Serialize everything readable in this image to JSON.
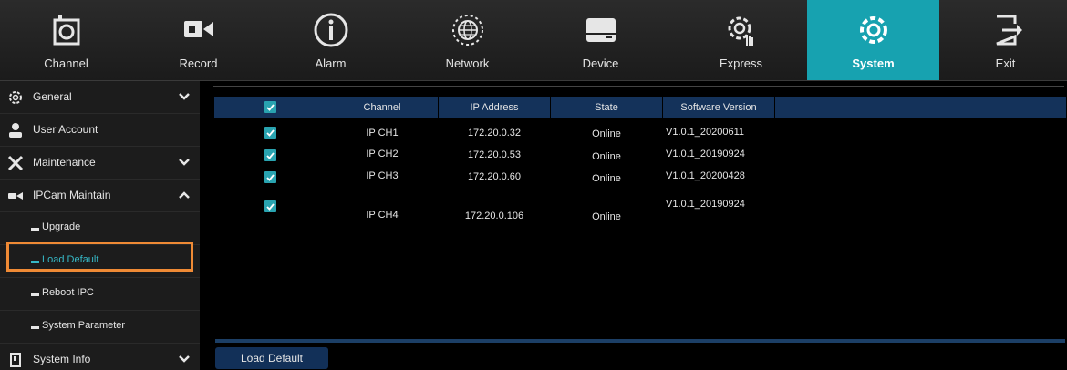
{
  "top_tabs": [
    {
      "label": "Channel",
      "icon": "camera-icon"
    },
    {
      "label": "Record",
      "icon": "video-camera-icon"
    },
    {
      "label": "Alarm",
      "icon": "info-icon"
    },
    {
      "label": "Network",
      "icon": "globe-icon"
    },
    {
      "label": "Device",
      "icon": "hard-drive-icon"
    },
    {
      "label": "Express",
      "icon": "gear-hand-icon"
    },
    {
      "label": "System",
      "icon": "gear-icon",
      "active": true
    },
    {
      "label": "Exit",
      "icon": "exit-icon"
    }
  ],
  "sidebar": {
    "items": [
      {
        "label": "General",
        "icon": "gear-icon",
        "chevron": "down"
      },
      {
        "label": "User Account",
        "icon": "user-icon"
      },
      {
        "label": "Maintenance",
        "icon": "tools-icon",
        "chevron": "down"
      },
      {
        "label": "IPCam Maintain",
        "icon": "ipcam-icon",
        "chevron": "up"
      },
      {
        "label": "Upgrade",
        "sub": true
      },
      {
        "label": "Load Default",
        "sub": true,
        "active": true
      },
      {
        "label": "Reboot IPC",
        "sub": true
      },
      {
        "label": "System Parameter",
        "sub": true
      },
      {
        "label": "System Info",
        "icon": "info-doc-icon",
        "chevron": "down"
      }
    ]
  },
  "table": {
    "headers": {
      "channel": "Channel",
      "ip": "IP Address",
      "state": "State",
      "version": "Software Version"
    },
    "rows": [
      {
        "checked": true,
        "channel": "IP CH1",
        "ip": "172.20.0.32",
        "state": "Online",
        "version": "V1.0.1_20200611"
      },
      {
        "checked": true,
        "channel": "IP CH2",
        "ip": "172.20.0.53",
        "state": "Online",
        "version": "V1.0.1_20190924"
      },
      {
        "checked": true,
        "channel": "IP CH3",
        "ip": "172.20.0.60",
        "state": "Online",
        "version": "V1.0.1_20200428"
      },
      {
        "checked": true,
        "channel": "IP CH4",
        "ip": "172.20.0.106",
        "state": "Online",
        "version": "V1.0.1_20190924"
      }
    ]
  },
  "load_default_button": "Load Default",
  "colors": {
    "accent": "#17a2b0",
    "highlight": "#ef8a35",
    "header_row": "#14325a",
    "button": "#123058"
  }
}
